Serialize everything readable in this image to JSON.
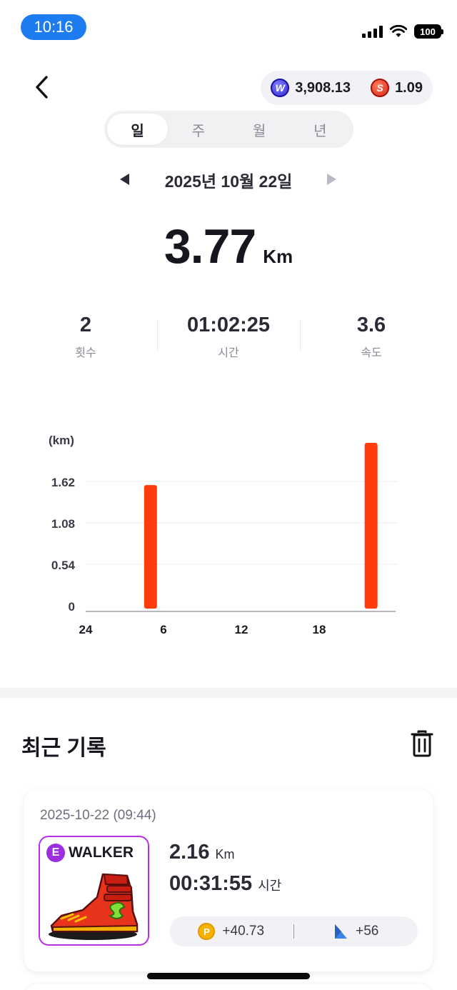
{
  "status_bar": {
    "time": "10:16",
    "battery": "100"
  },
  "header": {
    "balance_w": "3,908.13",
    "balance_s": "1.09",
    "coin_w_letter": "W",
    "coin_s_letter": "S"
  },
  "tabs": [
    {
      "label": "일",
      "active": true
    },
    {
      "label": "주",
      "active": false
    },
    {
      "label": "월",
      "active": false
    },
    {
      "label": "년",
      "active": false
    }
  ],
  "date": "2025년 10월 22일",
  "summary": {
    "distance": "3.77",
    "unit": "Km"
  },
  "stats": [
    {
      "value": "2",
      "label": "횟수"
    },
    {
      "value": "01:02:25",
      "label": "시간"
    },
    {
      "value": "3.6",
      "label": "속도"
    }
  ],
  "chart_data": {
    "type": "bar",
    "ylabel": "(km)",
    "y_ticks": [
      "0",
      "0.54",
      "1.08",
      "1.62"
    ],
    "x_ticks": [
      "24",
      "6",
      "12",
      "18"
    ],
    "x_tick_values": [
      0,
      6,
      12,
      18
    ],
    "xlim": [
      0,
      24
    ],
    "ylim": [
      0,
      1.62
    ],
    "bar_x": [
      5,
      22
    ],
    "values": [
      1.61,
      2.16
    ],
    "color": "#ff3d0a",
    "grid": true
  },
  "recent": {
    "title": "최근 기록",
    "records": [
      {
        "date": "2025-10-22 (09:44)",
        "shoe_grade": "E",
        "shoe_type": "WALKER",
        "distance": "2.16",
        "distance_unit": "Km",
        "time": "00:31:55",
        "time_unit": "시간",
        "reward_p_icon": "P",
        "reward_p": "+40.73",
        "reward_gem": "+56"
      }
    ]
  },
  "colors": {
    "accent_bar": "#ff3d0a",
    "grade_purple": "#9b2fe0",
    "status_blue": "#1c7cf0"
  }
}
